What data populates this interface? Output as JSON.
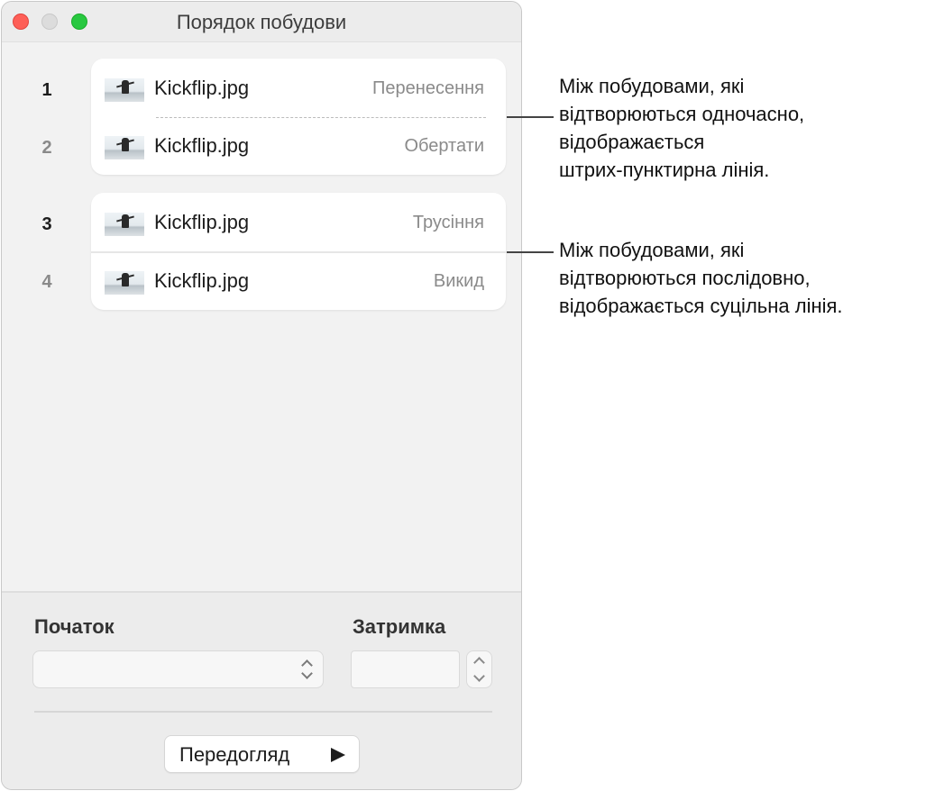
{
  "window": {
    "title": "Порядок побудови"
  },
  "builds": [
    {
      "number": "1",
      "file": "Kickflip.jpg",
      "effect": "Перенесення"
    },
    {
      "number": "2",
      "file": "Kickflip.jpg",
      "effect": "Обертати"
    },
    {
      "number": "3",
      "file": "Kickflip.jpg",
      "effect": "Трусіння"
    },
    {
      "number": "4",
      "file": "Kickflip.jpg",
      "effect": "Викид"
    }
  ],
  "controls": {
    "start_label": "Початок",
    "start_value": "",
    "delay_label": "Затримка",
    "delay_value": "",
    "preview_label": "Передогляд"
  },
  "callouts": [
    {
      "lines": [
        "Між побудовами, які",
        "відтворюються одночасно,",
        "відображається",
        "штрих-пунктирна лінія."
      ]
    },
    {
      "lines": [
        "Між побудовами, які",
        "відтворюються послідовно,",
        "відображається суцільна лінія."
      ]
    }
  ]
}
